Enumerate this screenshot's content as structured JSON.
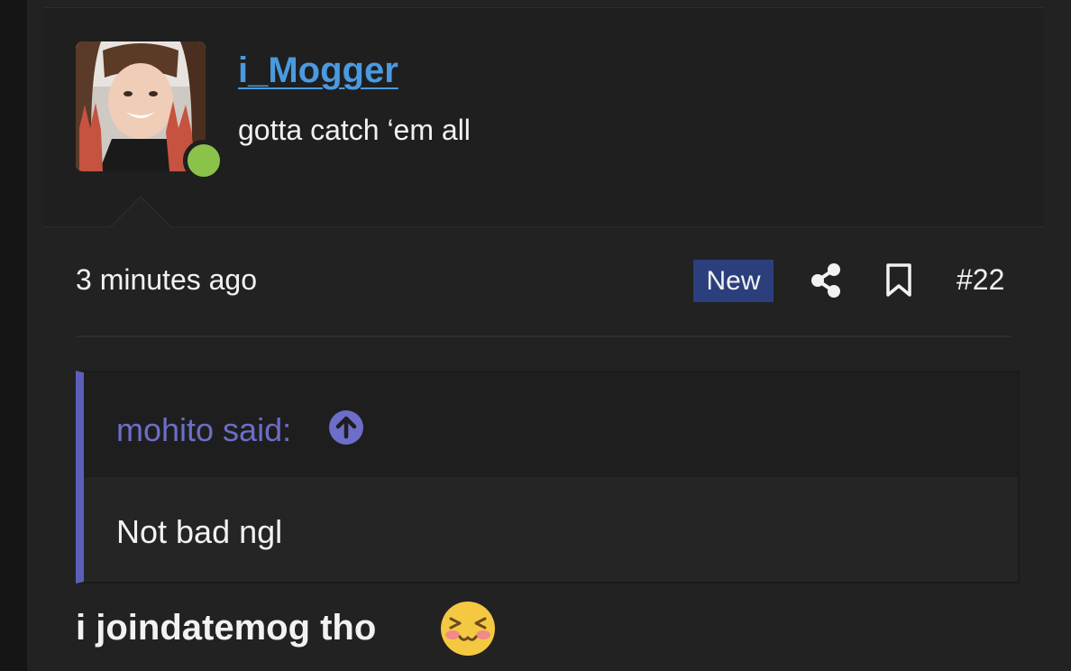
{
  "user": {
    "name": "i_Mogger",
    "title": "gotta catch ‘em all",
    "online_color": "#8bc34a",
    "avatar_icon": "avatar-photo"
  },
  "meta": {
    "timestamp": "3 minutes ago",
    "badge": "New",
    "post_number": "#22",
    "share_icon": "share-icon",
    "bookmark_icon": "bookmark-icon"
  },
  "quote": {
    "author": "mohito said:",
    "body": "Not bad ngl",
    "accent_color": "#5c5fb8",
    "jump_icon": "arrow-up-circle-icon"
  },
  "message": {
    "text": "i joindatemog tho",
    "emoji": "flushed-smile-emoji"
  },
  "colors": {
    "link": "#4a9ae0",
    "badge_bg": "#2b3f7c",
    "quote_author": "#6c6ec9"
  }
}
